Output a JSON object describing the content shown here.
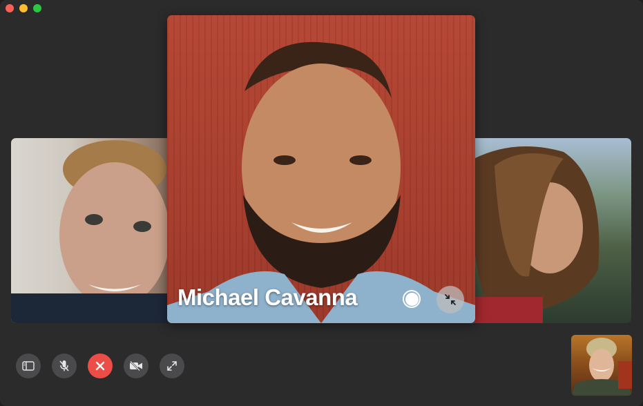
{
  "window": {
    "traffic_lights": [
      "close",
      "minimize",
      "zoom"
    ],
    "colors": {
      "close": "#fe5f57",
      "minimize": "#febc2e",
      "zoom": "#28c840"
    }
  },
  "participants": {
    "main": {
      "name": "Michael Cavanna"
    }
  },
  "tile_controls": {
    "capture_icon": "live-photo-capture-icon",
    "collapse_icon": "collapse-arrows-icon"
  },
  "toolbar": {
    "buttons": [
      {
        "name": "sidebar",
        "icon": "sidebar-icon"
      },
      {
        "name": "mute",
        "icon": "microphone-slash-icon"
      },
      {
        "name": "end-call",
        "icon": "x-icon",
        "color": "#ec4e47"
      },
      {
        "name": "video-off",
        "icon": "video-slash-icon"
      },
      {
        "name": "fullscreen",
        "icon": "expand-arrows-icon"
      }
    ]
  }
}
